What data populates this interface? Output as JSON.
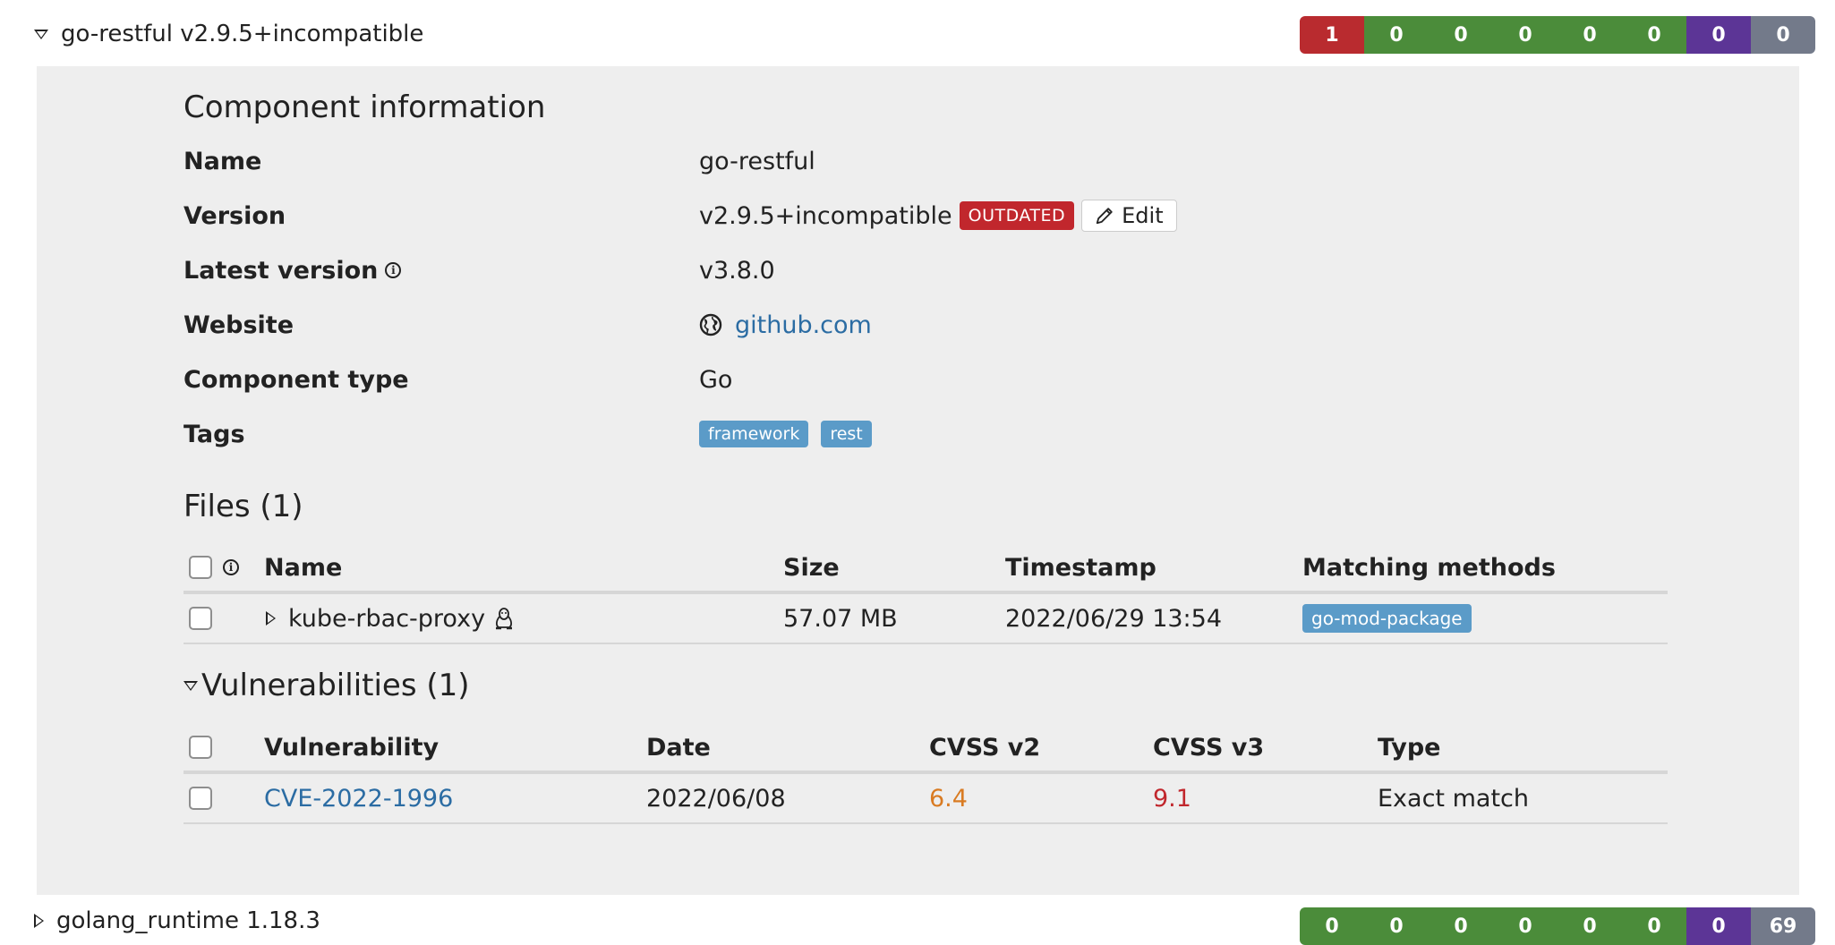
{
  "component": {
    "title": "go-restful v2.9.5+incompatible",
    "counts": [
      {
        "value": "1",
        "color": "#b92b2f"
      },
      {
        "value": "0",
        "color": "#4b8c3a"
      },
      {
        "value": "0",
        "color": "#4b8c3a"
      },
      {
        "value": "0",
        "color": "#4b8c3a"
      },
      {
        "value": "0",
        "color": "#4b8c3a"
      },
      {
        "value": "0",
        "color": "#4b8c3a"
      },
      {
        "value": "0",
        "color": "#5c3596"
      },
      {
        "value": "0",
        "color": "#737a8a"
      }
    ]
  },
  "info": {
    "heading": "Component information",
    "name_label": "Name",
    "name_value": "go-restful",
    "version_label": "Version",
    "version_value": "v2.9.5+incompatible",
    "outdated_badge": "OUTDATED",
    "edit_label": "Edit",
    "latest_label": "Latest version",
    "latest_value": "v3.8.0",
    "website_label": "Website",
    "website_value": "github.com",
    "type_label": "Component type",
    "type_value": "Go",
    "tags_label": "Tags",
    "tags": [
      "framework",
      "rest"
    ]
  },
  "files": {
    "heading": "Files (1)",
    "columns": {
      "name": "Name",
      "size": "Size",
      "timestamp": "Timestamp",
      "methods": "Matching methods"
    },
    "rows": [
      {
        "name": "kube-rbac-proxy",
        "size": "57.07 MB",
        "timestamp": "2022/06/29 13:54",
        "method": "go-mod-package"
      }
    ]
  },
  "vulns": {
    "heading": "Vulnerabilities (1)",
    "columns": {
      "vuln": "Vulnerability",
      "date": "Date",
      "cvss2": "CVSS v2",
      "cvss3": "CVSS v3",
      "type": "Type"
    },
    "rows": [
      {
        "id": "CVE-2022-1996",
        "date": "2022/06/08",
        "cvss2": "6.4",
        "cvss3": "9.1",
        "type": "Exact match"
      }
    ],
    "colors": {
      "cvss2": "#d97b22",
      "cvss3": "#c1272d"
    }
  },
  "next_component": {
    "title": "golang_runtime 1.18.3",
    "counts": [
      {
        "value": "0",
        "color": "#4b8c3a"
      },
      {
        "value": "0",
        "color": "#4b8c3a"
      },
      {
        "value": "0",
        "color": "#4b8c3a"
      },
      {
        "value": "0",
        "color": "#4b8c3a"
      },
      {
        "value": "0",
        "color": "#4b8c3a"
      },
      {
        "value": "0",
        "color": "#4b8c3a"
      },
      {
        "value": "0",
        "color": "#5c3596"
      },
      {
        "value": "69",
        "color": "#737a8a"
      }
    ]
  }
}
